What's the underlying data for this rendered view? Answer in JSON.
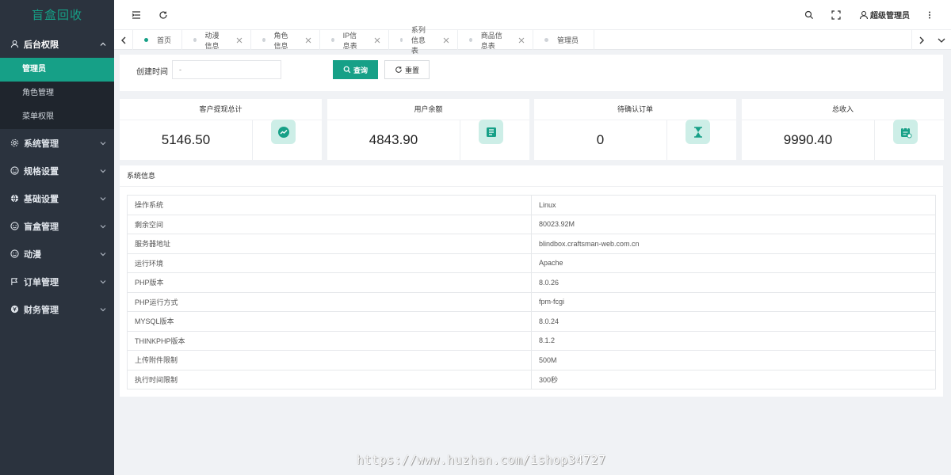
{
  "app": {
    "logo": "盲盒回收"
  },
  "sidebar": {
    "groups": [
      {
        "label": "后台权限",
        "icon": "user-icon",
        "open": true,
        "items": [
          {
            "label": "管理员",
            "active": true
          },
          {
            "label": "角色管理"
          },
          {
            "label": "菜单权限"
          }
        ]
      },
      {
        "label": "系统管理",
        "icon": "gear-icon"
      },
      {
        "label": "规格设置",
        "icon": "smile-icon"
      },
      {
        "label": "基础设置",
        "icon": "globe-icon"
      },
      {
        "label": "盲盒管理",
        "icon": "smile-icon"
      },
      {
        "label": "动漫",
        "icon": "smile-icon"
      },
      {
        "label": "订单管理",
        "icon": "flag-icon"
      },
      {
        "label": "财务管理",
        "icon": "money-icon"
      }
    ]
  },
  "header": {
    "username": "超级管理员"
  },
  "tabs": [
    {
      "label": "首页",
      "active": true,
      "closable": false
    },
    {
      "label": "动漫信息",
      "closable": true
    },
    {
      "label": "角色信息",
      "closable": true
    },
    {
      "label": "IP信息表",
      "closable": true
    },
    {
      "label": "系列信息表",
      "closable": true
    },
    {
      "label": "商品信息表",
      "closable": true
    },
    {
      "label": "管理员",
      "closable": false
    }
  ],
  "filter": {
    "label": "创建时间",
    "value": "-",
    "query_label": "查询",
    "reset_label": "重置"
  },
  "stats": [
    {
      "title": "客户提现总计",
      "value": "5146.50",
      "icon": "trend-icon"
    },
    {
      "title": "用户余额",
      "value": "4843.90",
      "icon": "wallet-icon"
    },
    {
      "title": "待确认订单",
      "value": "0",
      "icon": "hourglass-icon"
    },
    {
      "title": "总收入",
      "value": "9990.40",
      "icon": "calendar-money-icon"
    }
  ],
  "sysinfo": {
    "title": "系统信息",
    "rows": [
      {
        "k": "操作系统",
        "v": "Linux"
      },
      {
        "k": "剩余空间",
        "v": "80023.92M"
      },
      {
        "k": "服务器地址",
        "v": "blindbox.craftsman-web.com.cn"
      },
      {
        "k": "运行环境",
        "v": "Apache"
      },
      {
        "k": "PHP版本",
        "v": "8.0.26"
      },
      {
        "k": "PHP运行方式",
        "v": "fpm-fcgi"
      },
      {
        "k": "MYSQL版本",
        "v": "8.0.24"
      },
      {
        "k": "THINKPHP版本",
        "v": "8.1.2"
      },
      {
        "k": "上传附件限制",
        "v": "500M"
      },
      {
        "k": "执行时间限制",
        "v": "300秒"
      }
    ]
  },
  "watermark": "https://www.huzhan.com/ishop34727",
  "colors": {
    "accent": "#16a087",
    "sidebar": "#2b333e",
    "sidebar_sub": "#1f252d"
  }
}
